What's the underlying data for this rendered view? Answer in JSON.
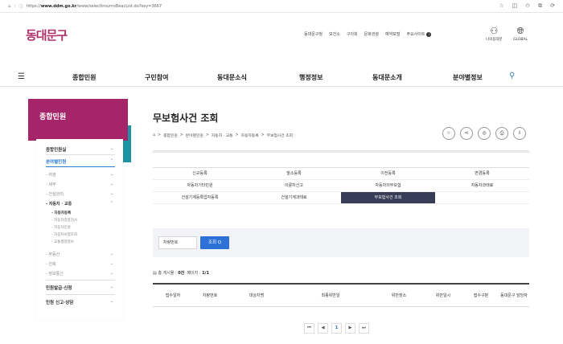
{
  "browser": {
    "url_prefix": "https://",
    "url_domain": "www.ddm.go.kr",
    "url_path": "/www/selectInsurnsBeacList.do?key=3667",
    "icons": [
      "home-icon",
      "info-icon",
      "star-icon",
      "split-icon",
      "favorites-icon",
      "collections-icon",
      "sync-icon"
    ]
  },
  "header": {
    "logo": "동대문구",
    "util_links": [
      "동대문구청",
      "보건소",
      "구의회",
      "문화관광",
      "예약포털",
      "주요사이트"
    ],
    "util_badge": "i",
    "login_label": "나의동대문",
    "global_label": "GLOBAL"
  },
  "gnb": {
    "items": [
      "종합민원",
      "구민참여",
      "동대문소식",
      "행정정보",
      "동대문소개",
      "분야별정보"
    ]
  },
  "sidebar": {
    "title": "종합민원",
    "groups": [
      {
        "label": "종합민원실",
        "chevron": "⌄"
      },
      {
        "label": "분야별민원",
        "chevron": "⌃"
      }
    ],
    "sub_items": [
      "- 여권",
      "- 세무",
      "- 건설관리",
      "- 자동차 · 교통",
      "- 부동산",
      "- 건축",
      "- 정보통신"
    ],
    "chevrons": [
      "⌄",
      "⌄",
      "⌄",
      "⌃",
      "⌄",
      "⌄",
      "⌄"
    ],
    "third_items": [
      "- 자동차등록",
      "- 자동차종합검사",
      "- 자동차민원",
      "- 자동차보험조회",
      "- 교통행정정보"
    ],
    "bottom_groups": [
      {
        "label": "민원발급·신청",
        "chevron": "⌄"
      },
      {
        "label": "민원 신고·상담",
        "chevron": "⌄"
      }
    ]
  },
  "content": {
    "title": "무보험사건 조회",
    "breadcrumb": [
      "종합민원",
      "분야별민원",
      "자동차 · 교통",
      "자동차등록",
      "무보험사건 조회"
    ],
    "breadcrumb_sep": ">",
    "tools": [
      "☆",
      "⋖",
      "◎",
      "⎙",
      "⇩"
    ],
    "tabs": [
      [
        "신규등록",
        "말소등록",
        "이전등록",
        "변경등록"
      ],
      [
        "자동차기타민원",
        "이륜차신고",
        "자동차의무보험",
        "자동차과태료"
      ],
      [
        "건설기계등록업자등록",
        "건설기계과태료",
        "무보험사건 조회",
        ""
      ]
    ],
    "selected_tab": "무보험사건 조회",
    "search_field": "차량번호",
    "search_button": "조회 Q",
    "count_label": "총 게시물 :",
    "count_value": "0건",
    "page_label": "페이지 :",
    "page_value": "1/1",
    "table_headers": [
      "접수일자",
      "차량번호",
      "대상차명",
      "최종위반일",
      "위반장소",
      "위반일시",
      "접수구분",
      "동대문구 담당자"
    ],
    "pager": [
      "⏮",
      "◀",
      "1",
      "▶",
      "⏭"
    ]
  }
}
